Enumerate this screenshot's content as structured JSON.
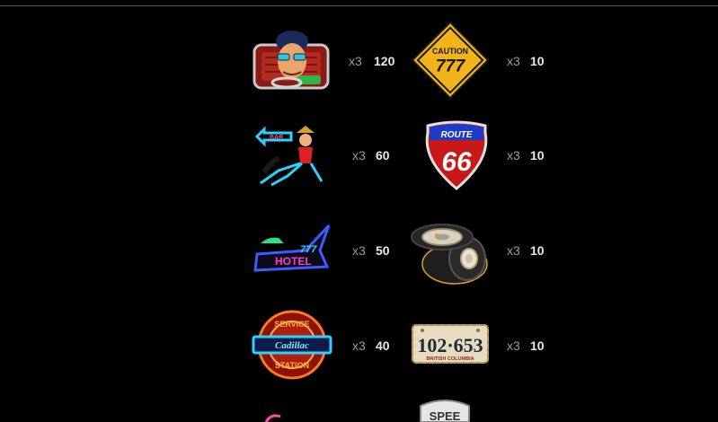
{
  "paytable": {
    "left": [
      {
        "symbol": "driver-symbol",
        "mult": "x3",
        "payout": "120"
      },
      {
        "symbol": "neon-bar-girl-symbol",
        "mult": "x3",
        "payout": "60"
      },
      {
        "symbol": "neon-hotel-sign-symbol",
        "mult": "x3",
        "payout": "50"
      },
      {
        "symbol": "service-station-sign-symbol",
        "mult": "x3",
        "payout": "40"
      }
    ],
    "right": [
      {
        "symbol": "caution-777-sign-symbol",
        "mult": "x3",
        "payout": "10"
      },
      {
        "symbol": "route-66-shield-symbol",
        "mult": "x3",
        "payout": "10"
      },
      {
        "symbol": "tires-symbol",
        "mult": "x3",
        "payout": "10"
      },
      {
        "symbol": "license-plate-symbol",
        "mult": "x3",
        "payout": "10"
      }
    ]
  },
  "sign_texts": {
    "bar": "BAR",
    "hotel_num": "777",
    "hotel": "HOTEL",
    "service": "SERVICE",
    "cadillac": "Cadillac",
    "station": "STATION",
    "caution": "CAUTION",
    "caution_num": "777",
    "route": "ROUTE",
    "route_num": "66",
    "plate_num": "102·653",
    "plate_region": "BRITISH COLUMBIA",
    "speed": "SPEE"
  }
}
